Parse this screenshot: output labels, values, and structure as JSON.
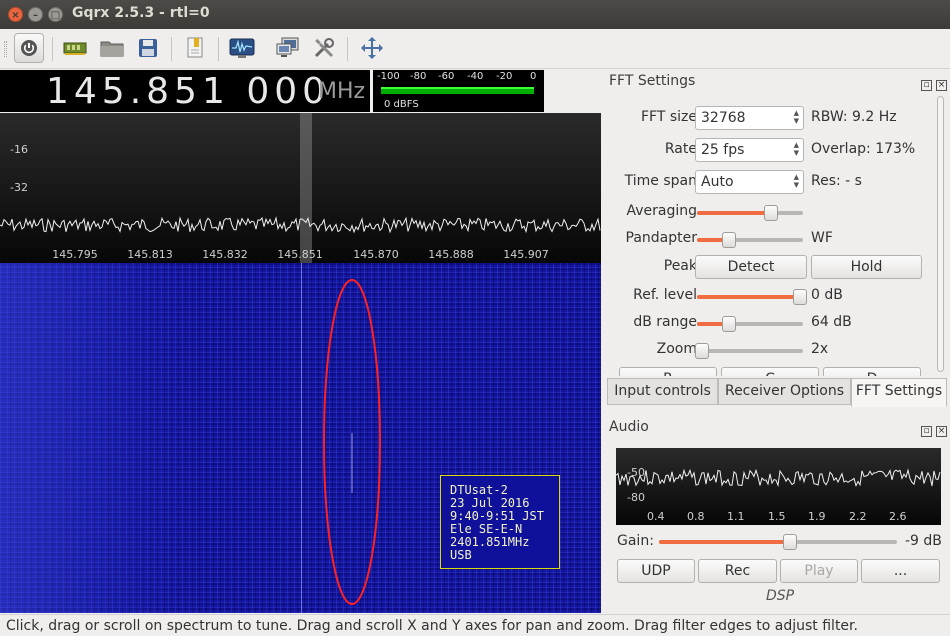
{
  "window": {
    "title": "Gqrx 2.5.3 - rtl=0"
  },
  "toolbar": {
    "buttons": [
      "power-icon",
      "device-icon",
      "open-icon",
      "save-icon",
      "bookmark-icon",
      "waveform-icon",
      "network-icon",
      "tools-icon",
      "fullscreen-icon"
    ]
  },
  "frequency": {
    "value": "145.851 000",
    "unit": "MHz"
  },
  "signal_meter": {
    "scale": [
      "-100",
      "-80",
      "-60",
      "-40",
      "-20",
      "0"
    ],
    "level_label": "0 dBFS",
    "level_fraction": 0.98
  },
  "spectrum": {
    "y_ticks": [
      "-16",
      "-32"
    ],
    "x_ticks": [
      "145.795",
      "145.813",
      "145.832",
      "145.851",
      "145.870",
      "145.888",
      "145.907"
    ]
  },
  "annotation": {
    "lines": [
      "DTUsat-2",
      "23 Jul 2016",
      "9:40-9:51 JST",
      "Ele SE-E-N",
      "2401.851MHz",
      "USB"
    ]
  },
  "fft_settings": {
    "title": "FFT Settings",
    "fft_size_label": "FFT size",
    "fft_size_value": "32768",
    "rbw": "RBW: 9.2 Hz",
    "rate_label": "Rate",
    "rate_value": "25 fps",
    "overlap": "Overlap: 173%",
    "timespan_label": "Time span",
    "timespan_value": "Auto",
    "res": "Res: - s",
    "averaging_label": "Averaging",
    "averaging_level": 0.7,
    "pandapter_label": "Pandapter",
    "pandapter_level": 0.3,
    "pandapter_value": "WF",
    "peak_label": "Peak",
    "detect_button": "Detect",
    "hold_button": "Hold",
    "ref_level_label": "Ref. level",
    "ref_level_level": 0.97,
    "ref_level_value": "0 dB",
    "db_range_label": "dB range",
    "db_range_level": 0.3,
    "db_range_value": "64 dB",
    "zoom_label": "Zoom",
    "zoom_level": 0.05,
    "zoom_value": "2x",
    "cutoff_buttons": [
      "R",
      "C",
      "D"
    ]
  },
  "tabs": [
    {
      "label": "Input controls",
      "active": false
    },
    {
      "label": "Receiver Options",
      "active": false
    },
    {
      "label": "FFT Settings",
      "active": true
    }
  ],
  "audio": {
    "title": "Audio",
    "y_ticks": [
      "-50",
      "-80"
    ],
    "x_ticks": [
      "0.4",
      "0.8",
      "1.1",
      "1.5",
      "1.9",
      "2.2",
      "2.6"
    ],
    "gain_label": "Gain:",
    "gain_value": "-9 dB",
    "gain_level": 0.55,
    "udp_button": "UDP",
    "rec_button": "Rec",
    "play_button": "Play",
    "more_button": "...",
    "dsp_label": "DSP"
  },
  "colors": {
    "waterfall": "#15169e",
    "annotation_border": "#d8d80a",
    "ellipse": "#ff2020",
    "slider_fill": "#ef6d40",
    "meter": "#00b000"
  },
  "status_bar": {
    "text": "Click, drag or scroll on spectrum to tune. Drag and scroll X and Y axes for pan and zoom. Drag filter edges to adjust filter."
  }
}
